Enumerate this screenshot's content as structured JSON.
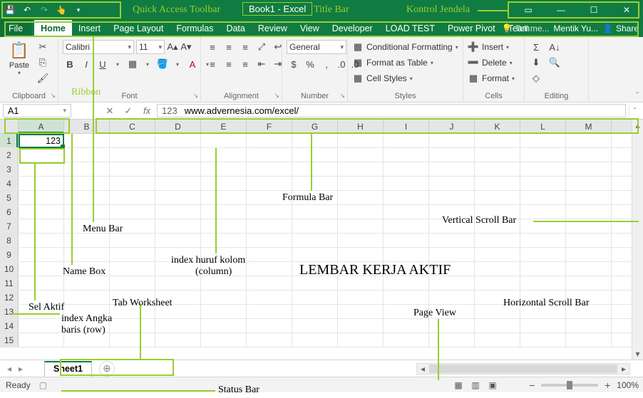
{
  "title": "Book1 - Excel",
  "qat_annotation": "Quick Access Toolbar",
  "titlebar_annotation": "Title Bar",
  "winctrl_annotation": "Kontrol Jendela",
  "tabs": {
    "file": "File",
    "home": "Home",
    "insert": "Insert",
    "pageLayout": "Page Layout",
    "formulas": "Formulas",
    "data": "Data",
    "review": "Review",
    "view": "View",
    "developer": "Developer",
    "loadTest": "LOAD TEST",
    "powerPivot": "Power Pivot",
    "team": "Team"
  },
  "tellme": "Tell me...",
  "user": "Mentik Yu...",
  "share": "Share",
  "ribbon": {
    "paste": "Paste",
    "clipboard": "Clipboard",
    "font": "Font",
    "fontname": "Calibri",
    "fontsize": "11",
    "alignment": "Alignment",
    "number": "Number",
    "numberFormat": "General",
    "styles": "Styles",
    "condfmt": "Conditional Formatting",
    "fmttable": "Format as Table",
    "cellstyles": "Cell Styles",
    "cells": "Cells",
    "insert": "Insert",
    "delete": "Delete",
    "format": "Format",
    "editing": "Editing",
    "ribbon_annotation": "Ribbon"
  },
  "namebox": "A1",
  "formula": "www.advernesia.com/excel/",
  "formula_prefix": "123",
  "cellA1": "123",
  "columns": [
    "A",
    "B",
    "C",
    "D",
    "E",
    "F",
    "G",
    "H",
    "I",
    "J",
    "K",
    "L",
    "M"
  ],
  "rows": [
    "1",
    "2",
    "3",
    "4",
    "5",
    "6",
    "7",
    "8",
    "9",
    "10",
    "11",
    "12",
    "13",
    "14",
    "15"
  ],
  "sheet1": "Sheet1",
  "status": {
    "ready": "Ready",
    "zoom": "100%"
  },
  "annotations": {
    "menubar": "Menu Bar",
    "namebox": "Name Box",
    "selaktif": "Sel Aktif",
    "indexrow1": "index Angka",
    "indexrow2": "baris (row)",
    "tabws": "Tab Worksheet",
    "indexcol1": "index huruf kolom",
    "indexcol2": "(column)",
    "formulabar": "Formula Bar",
    "lembar": "LEMBAR KERJA AKTIF",
    "vscroll": "Vertical Scroll Bar",
    "hscroll": "Horizontal Scroll Bar",
    "pageview": "Page View",
    "statusbar": "Status Bar"
  }
}
